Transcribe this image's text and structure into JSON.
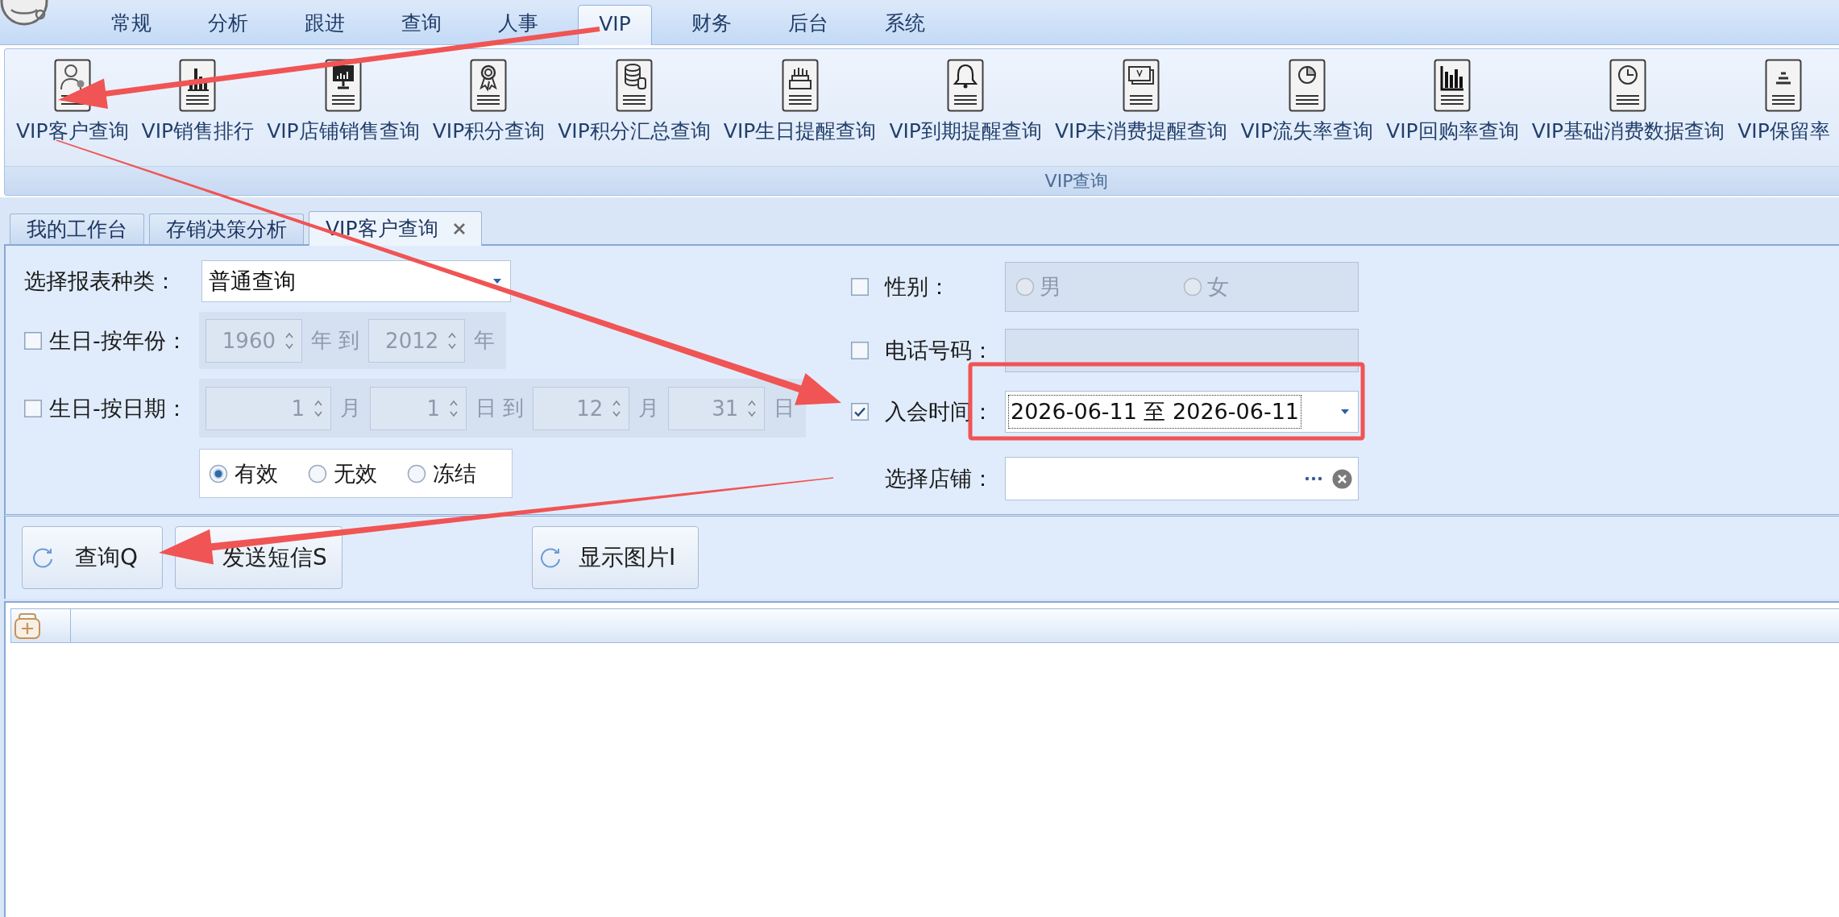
{
  "menu_tabs": [
    {
      "label": "常规",
      "selected": false
    },
    {
      "label": "分析",
      "selected": false
    },
    {
      "label": "跟进",
      "selected": false
    },
    {
      "label": "查询",
      "selected": false
    },
    {
      "label": "人事",
      "selected": false
    },
    {
      "label": "VIP",
      "selected": true
    },
    {
      "label": "财务",
      "selected": false
    },
    {
      "label": "后台",
      "selected": false
    },
    {
      "label": "系统",
      "selected": false
    }
  ],
  "ribbon": {
    "items": [
      {
        "label": "VIP客户查询"
      },
      {
        "label": "VIP销售排行"
      },
      {
        "label": "VIP店铺销售查询"
      },
      {
        "label": "VIP积分查询"
      },
      {
        "label": "VIP积分汇总查询"
      },
      {
        "label": "VIP生日提醒查询"
      },
      {
        "label": "VIP到期提醒查询"
      },
      {
        "label": "VIP未消费提醒查询"
      },
      {
        "label": "VIP流失率查询"
      },
      {
        "label": "VIP回购率查询"
      },
      {
        "label": "VIP基础消费数据查询"
      },
      {
        "label": "VIP保留率"
      }
    ],
    "group_caption": "VIP查询"
  },
  "document_tabs": [
    {
      "label": "我的工作台",
      "selected": false
    },
    {
      "label": "存销决策分析",
      "selected": false
    },
    {
      "label": "VIP客户查询",
      "selected": true
    }
  ],
  "query_form": {
    "report_type": {
      "label": "选择报表种类：",
      "value": "普通查询"
    },
    "birthday_year": {
      "checked": false,
      "label": "生日-按年份：",
      "fields": [
        {
          "value": "1960",
          "unit": "年 到"
        },
        {
          "value": "2012",
          "unit": "年"
        }
      ]
    },
    "birthday_date": {
      "checked": false,
      "label": "生日-按日期：",
      "fields": [
        {
          "value": "1",
          "unit": "月"
        },
        {
          "value": "1",
          "unit": "日 到"
        },
        {
          "value": "12",
          "unit": "月"
        },
        {
          "value": "31",
          "unit": "日"
        }
      ]
    },
    "status_options": [
      {
        "label": "有效",
        "selected": true
      },
      {
        "label": "无效",
        "selected": false
      },
      {
        "label": "冻结",
        "selected": false
      }
    ],
    "gender": {
      "checked": false,
      "label": "性别：",
      "options": [
        {
          "label": "男",
          "selected": false
        },
        {
          "label": "女",
          "selected": false
        }
      ]
    },
    "phone": {
      "checked": false,
      "label": "电话号码："
    },
    "join_date": {
      "checked": true,
      "label": "入会时间：",
      "value": "2026-06-11 至 2026-06-11"
    },
    "store": {
      "label": "选择店铺："
    }
  },
  "buttons": [
    {
      "label": "查询Q"
    },
    {
      "label": "发送短信S"
    },
    {
      "label": "显示图片I"
    }
  ],
  "annotations": [
    {
      "kind": "arrow"
    },
    {
      "kind": "arrow"
    },
    {
      "kind": "arrow"
    },
    {
      "kind": "box"
    }
  ]
}
